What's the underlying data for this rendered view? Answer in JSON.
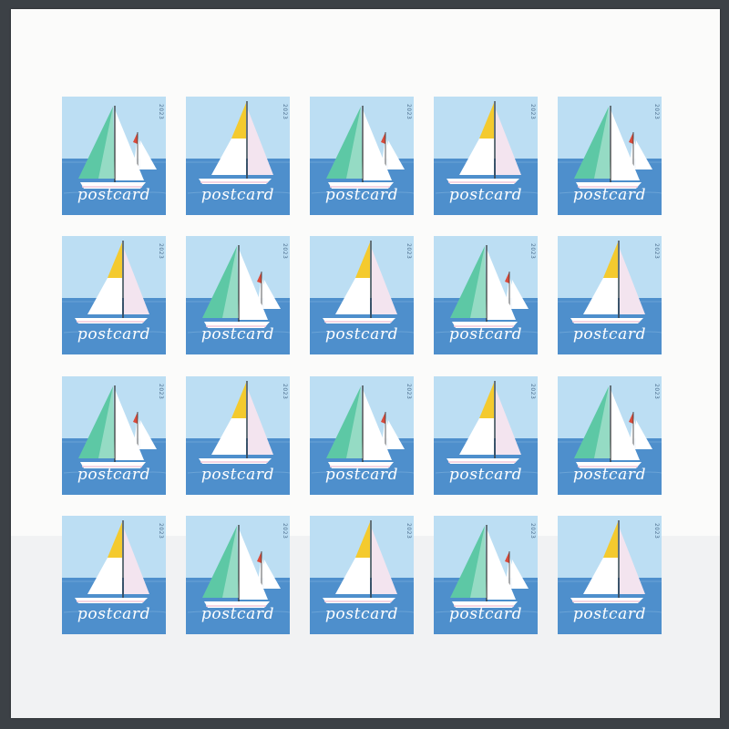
{
  "sheet": {
    "colors": {
      "sky": "#bcdef3",
      "sea": "#4e8fcc",
      "sail_green": "#5dc8a5",
      "sail_yellow": "#f4ca2e",
      "sail_white": "#ffffff",
      "sail_pink": "#f3e4ef",
      "pennant_red": "#d94a3a"
    },
    "stamps": [
      {
        "design": "green",
        "word": "postcard",
        "year": "2023"
      },
      {
        "design": "yellow",
        "word": "postcard",
        "year": "2023"
      },
      {
        "design": "green",
        "word": "postcard",
        "year": "2023"
      },
      {
        "design": "yellow",
        "word": "postcard",
        "year": "2023"
      },
      {
        "design": "green",
        "word": "postcard",
        "year": "2023"
      },
      {
        "design": "yellow",
        "word": "postcard",
        "year": "2023"
      },
      {
        "design": "green",
        "word": "postcard",
        "year": "2023"
      },
      {
        "design": "yellow",
        "word": "postcard",
        "year": "2023"
      },
      {
        "design": "green",
        "word": "postcard",
        "year": "2023"
      },
      {
        "design": "yellow",
        "word": "postcard",
        "year": "2023"
      },
      {
        "design": "green",
        "word": "postcard",
        "year": "2023"
      },
      {
        "design": "yellow",
        "word": "postcard",
        "year": "2023"
      },
      {
        "design": "green",
        "word": "postcard",
        "year": "2023"
      },
      {
        "design": "yellow",
        "word": "postcard",
        "year": "2023"
      },
      {
        "design": "green",
        "word": "postcard",
        "year": "2023"
      },
      {
        "design": "yellow",
        "word": "postcard",
        "year": "2023"
      },
      {
        "design": "green",
        "word": "postcard",
        "year": "2023"
      },
      {
        "design": "yellow",
        "word": "postcard",
        "year": "2023"
      },
      {
        "design": "green",
        "word": "postcard",
        "year": "2023"
      },
      {
        "design": "yellow",
        "word": "postcard",
        "year": "2023"
      }
    ]
  }
}
